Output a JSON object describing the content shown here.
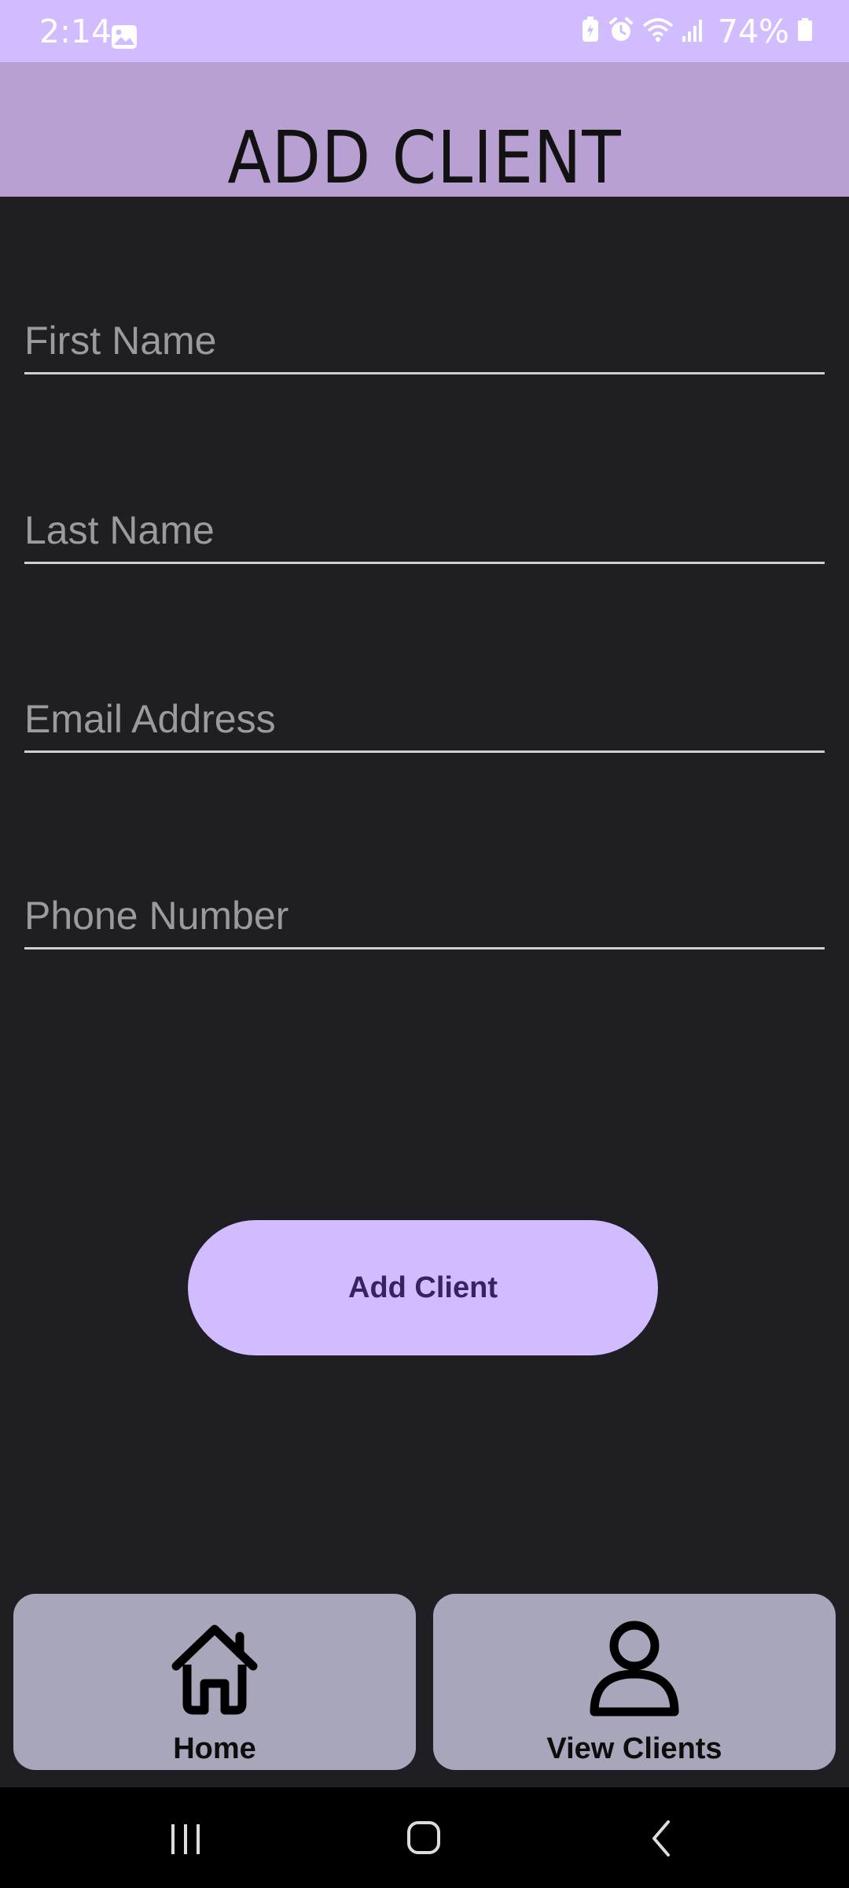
{
  "status_bar": {
    "time": "2:14",
    "battery": "74%",
    "icons": [
      "gallery-icon",
      "battery-saver-icon",
      "alarm-icon",
      "wifi-icon",
      "signal-icon",
      "battery-icon"
    ]
  },
  "header": {
    "title": "ADD CLIENT"
  },
  "form": {
    "first_name": {
      "placeholder": "First Name",
      "value": ""
    },
    "last_name": {
      "placeholder": "Last Name",
      "value": ""
    },
    "email": {
      "placeholder": "Email Address",
      "value": ""
    },
    "phone": {
      "placeholder": "Phone Number",
      "value": ""
    },
    "submit_label": "Add Client"
  },
  "bottom_nav": {
    "home_label": "Home",
    "home_icon": "home-icon",
    "clients_label": "View Clients",
    "clients_icon": "person-icon"
  },
  "system_nav": {
    "buttons": [
      "recents-icon",
      "home-circle-icon",
      "back-icon"
    ]
  },
  "colors": {
    "status_bar": "#d0bcff",
    "header": "#b8a0d2",
    "background": "#1f1e23",
    "button": "#d0bcff",
    "button_text": "#37235f",
    "nav_card": "#a8a6ba"
  }
}
